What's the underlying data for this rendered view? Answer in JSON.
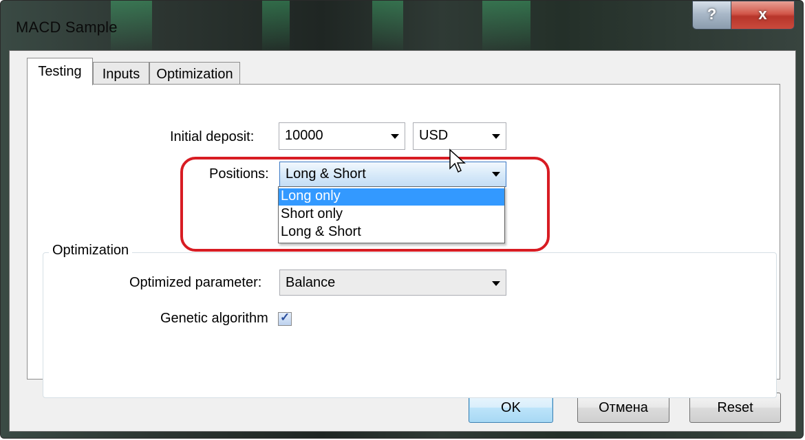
{
  "window": {
    "title": "MACD Sample",
    "help_label": "?",
    "close_label": "x"
  },
  "tabs": [
    {
      "label": "Testing",
      "active": true
    },
    {
      "label": "Inputs",
      "active": false
    },
    {
      "label": "Optimization",
      "active": false
    }
  ],
  "testing": {
    "initial_deposit_label": "Initial deposit:",
    "initial_deposit_value": "10000",
    "currency_value": "USD",
    "positions_label": "Positions:",
    "positions_value": "Long & Short",
    "positions_options": [
      "Long only",
      "Short only",
      "Long & Short"
    ],
    "positions_highlighted": "Long only"
  },
  "optimization_group": {
    "title": "Optimization",
    "optimized_parameter_label": "Optimized parameter:",
    "optimized_parameter_value": "Balance",
    "genetic_label": "Genetic algorithm",
    "genetic_checked": true,
    "check_glyph": "✓"
  },
  "buttons": {
    "ok": "OK",
    "cancel": "Отмена",
    "reset": "Reset"
  },
  "colors": {
    "highlight_ring": "#d81c23",
    "selection": "#3399ff"
  }
}
